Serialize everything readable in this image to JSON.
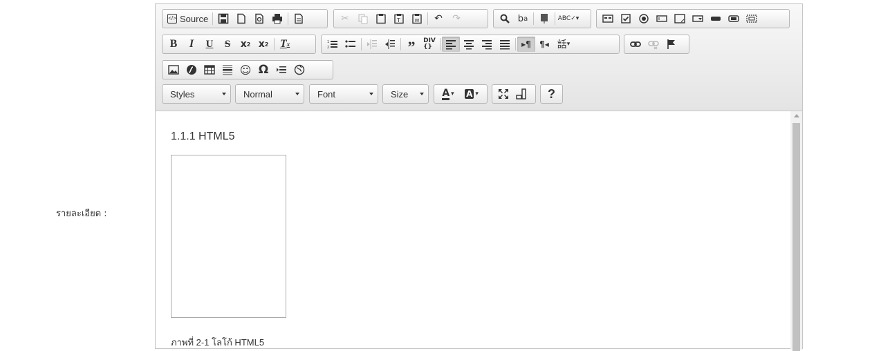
{
  "form": {
    "label": "รายละเอียด :"
  },
  "toolbar": {
    "source_label": "Source",
    "combos": {
      "styles": "Styles",
      "format": "Normal",
      "font": "Font",
      "size": "Size"
    },
    "help_label": "?"
  },
  "content": {
    "heading": "1.1.1 HTML5",
    "caption": "ภาพที่  2-1 โลโก้ HTML5"
  }
}
